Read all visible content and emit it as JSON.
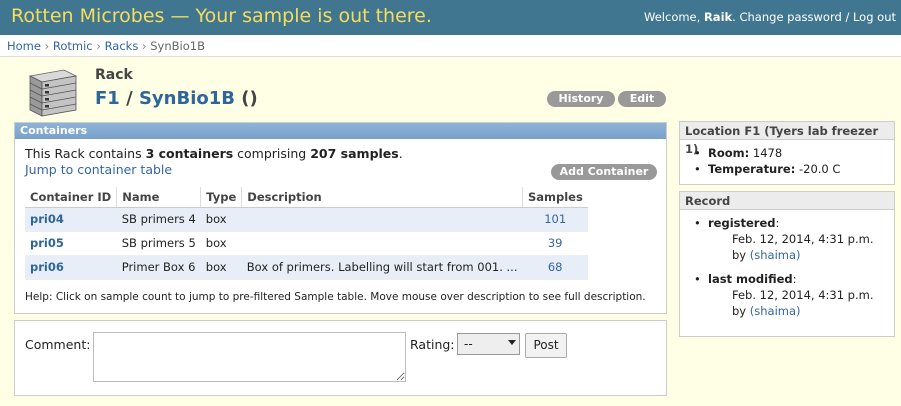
{
  "header": {
    "site_title": "Rotten Microbes — Your sample is out there.",
    "welcome": "Welcome,",
    "username": "Raik",
    "change_password": "Change password",
    "separator": "/",
    "logout": "Log out"
  },
  "breadcrumbs": [
    "Home",
    "Rotmic",
    "Racks",
    "SynBio1B"
  ],
  "rack": {
    "kind": "Rack",
    "location_link": "F1",
    "slash": "/",
    "name_link": "SynBio1B",
    "suffix": "()"
  },
  "actions": {
    "history": "History",
    "edit": "Edit"
  },
  "containers_panel": {
    "title": "Containers",
    "summary_prefix": "This Rack contains ",
    "summary_count": "3 containers",
    "summary_middle": " comprising ",
    "summary_samples": "207 samples",
    "summary_end": ".",
    "jump_link": "Jump to container table",
    "add_button": "Add Container",
    "columns": [
      "Container ID",
      "Name",
      "Type",
      "Description",
      "Samples"
    ],
    "rows": [
      {
        "id": "pri04",
        "name": "SB primers 4",
        "type": "box",
        "description": "",
        "samples": "101"
      },
      {
        "id": "pri05",
        "name": "SB primers 5",
        "type": "box",
        "description": "",
        "samples": "39"
      },
      {
        "id": "pri06",
        "name": "Primer Box 6",
        "type": "box",
        "description": "Box of primers. Labelling will start from 001. ...",
        "samples": "68"
      }
    ],
    "help": "Help: Click on sample count to jump to pre-filtered Sample table. Move mouse over description to see full description."
  },
  "comment_form": {
    "comment_label": "Comment:",
    "comment_value": "",
    "rating_label": "Rating:",
    "rating_value": "--",
    "post_button": "Post"
  },
  "location_panel": {
    "title": "Location F1 (Tyers lab freezer 1)",
    "room_label": "Room:",
    "room_value": "1478",
    "temp_label": "Temperature:",
    "temp_value": "-20.0 C"
  },
  "record_panel": {
    "title": "Record",
    "registered_label": "registered",
    "registered_date": "Feb. 12, 2014, 4:31 p.m.",
    "registered_by_prefix": "by",
    "registered_by": "(shaima)",
    "modified_label": "last modified",
    "modified_date": "Feb. 12, 2014, 4:31 p.m.",
    "modified_by_prefix": "by",
    "modified_by": "(shaima)",
    "colon": ":"
  },
  "colors": {
    "header_bg": "#417690",
    "title_color": "#f5dd5d",
    "link": "#3465a4",
    "page_bg": "#ffffe6",
    "panel_head": "#79a0c9"
  },
  "icons": {
    "rack": "rack-icon",
    "dropdown": "chevron-down-icon"
  }
}
